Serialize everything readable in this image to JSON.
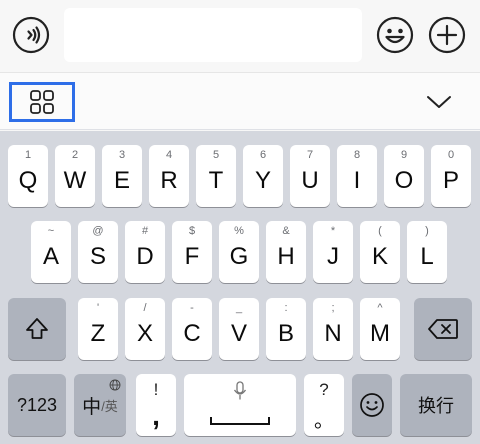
{
  "input_bar": {
    "text_value": ""
  },
  "keyboard": {
    "row1": [
      {
        "letter": "Q",
        "hint": "1"
      },
      {
        "letter": "W",
        "hint": "2"
      },
      {
        "letter": "E",
        "hint": "3"
      },
      {
        "letter": "R",
        "hint": "4"
      },
      {
        "letter": "T",
        "hint": "5"
      },
      {
        "letter": "Y",
        "hint": "6"
      },
      {
        "letter": "U",
        "hint": "7"
      },
      {
        "letter": "I",
        "hint": "8"
      },
      {
        "letter": "O",
        "hint": "9"
      },
      {
        "letter": "P",
        "hint": "0"
      }
    ],
    "row2": [
      {
        "letter": "A",
        "hint": "~"
      },
      {
        "letter": "S",
        "hint": "@"
      },
      {
        "letter": "D",
        "hint": "#"
      },
      {
        "letter": "F",
        "hint": "$"
      },
      {
        "letter": "G",
        "hint": "%"
      },
      {
        "letter": "H",
        "hint": "&"
      },
      {
        "letter": "J",
        "hint": "*"
      },
      {
        "letter": "K",
        "hint": "("
      },
      {
        "letter": "L",
        "hint": ")"
      }
    ],
    "row3": [
      {
        "letter": "Z",
        "hint": "'"
      },
      {
        "letter": "X",
        "hint": "/"
      },
      {
        "letter": "C",
        "hint": "-"
      },
      {
        "letter": "V",
        "hint": "_"
      },
      {
        "letter": "B",
        "hint": ":"
      },
      {
        "letter": "N",
        "hint": ";"
      },
      {
        "letter": "M",
        "hint": "^"
      }
    ],
    "bottom": {
      "symbols_label": "?123",
      "lang_main": "中",
      "lang_alt": "/英",
      "punct_top": "!",
      "punct_bottom": ",",
      "punct2_top": "?",
      "punct2_bottom": "。",
      "return_label": "换行"
    }
  }
}
